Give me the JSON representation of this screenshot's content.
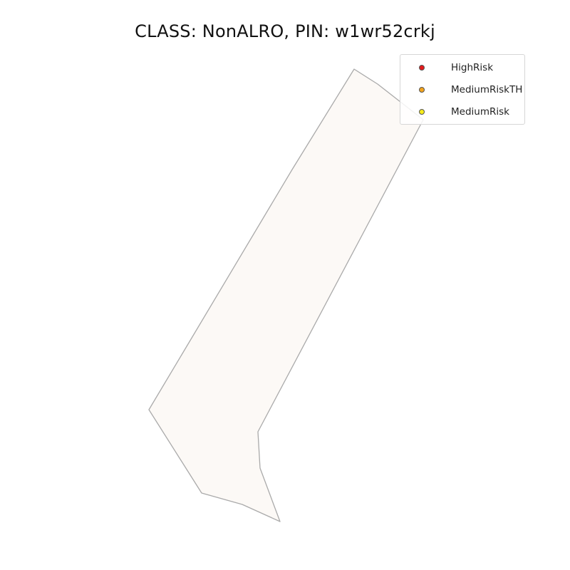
{
  "map": {
    "title": "CLASS: NonALRO, PIN: w1wr52crkj",
    "parcel": {
      "fill_color": "#fcf9f6",
      "stroke_color": "#aaaaaa"
    }
  },
  "legend": {
    "items": [
      {
        "label": "HighRisk",
        "color": "#e31a1c"
      },
      {
        "label": "MediumRiskTH",
        "color": "#f4a41c"
      },
      {
        "label": "MediumRisk",
        "color": "#f6ec1a"
      }
    ]
  }
}
